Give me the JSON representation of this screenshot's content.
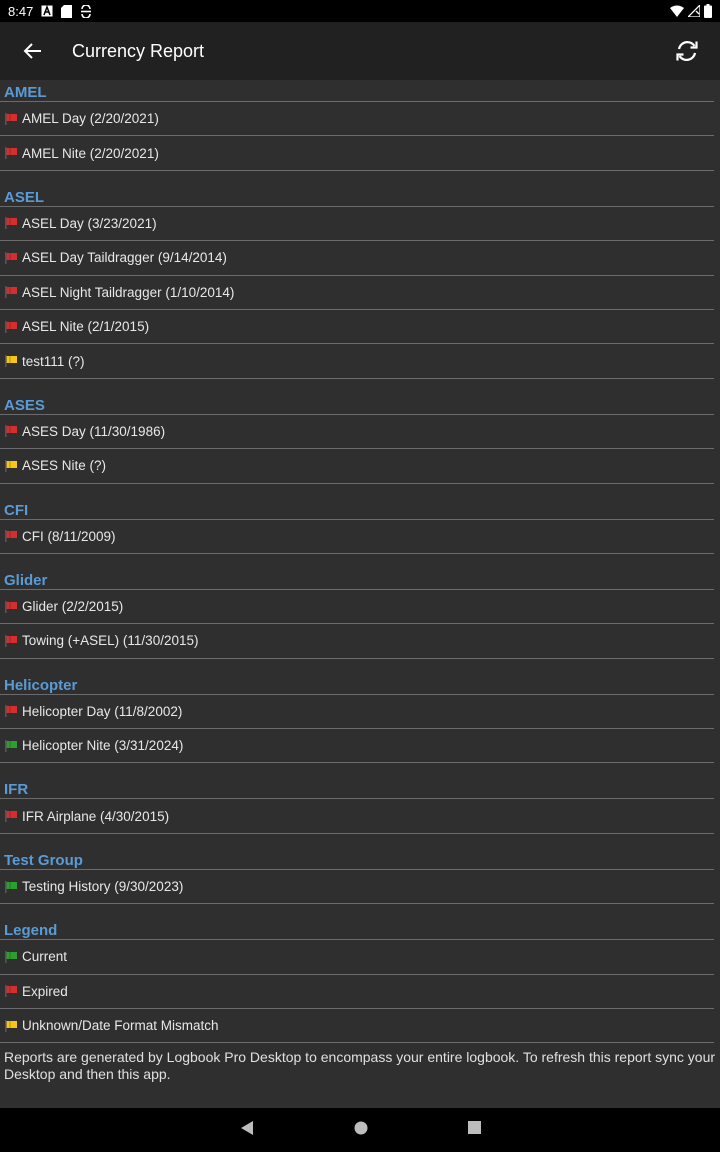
{
  "status": {
    "time": "8:47"
  },
  "appbar": {
    "title": "Currency Report"
  },
  "groups": [
    {
      "name": "AMEL",
      "items": [
        {
          "label": "AMEL Day (2/20/2021)",
          "flag": "red"
        },
        {
          "label": "AMEL Nite (2/20/2021)",
          "flag": "red"
        }
      ]
    },
    {
      "name": "ASEL",
      "items": [
        {
          "label": "ASEL Day (3/23/2021)",
          "flag": "red"
        },
        {
          "label": "ASEL Day Taildragger (9/14/2014)",
          "flag": "red"
        },
        {
          "label": "ASEL Night Taildragger (1/10/2014)",
          "flag": "red"
        },
        {
          "label": "ASEL Nite (2/1/2015)",
          "flag": "red"
        },
        {
          "label": "test111 (?)",
          "flag": "yellow"
        }
      ]
    },
    {
      "name": "ASES",
      "items": [
        {
          "label": "ASES Day (11/30/1986)",
          "flag": "red"
        },
        {
          "label": "ASES Nite (?)",
          "flag": "yellow"
        }
      ]
    },
    {
      "name": "CFI",
      "items": [
        {
          "label": "CFI (8/11/2009)",
          "flag": "red"
        }
      ]
    },
    {
      "name": "Glider",
      "items": [
        {
          "label": "Glider (2/2/2015)",
          "flag": "red"
        },
        {
          "label": "Towing (+ASEL) (11/30/2015)",
          "flag": "red"
        }
      ]
    },
    {
      "name": "Helicopter",
      "items": [
        {
          "label": "Helicopter Day (11/8/2002)",
          "flag": "red"
        },
        {
          "label": "Helicopter Nite (3/31/2024)",
          "flag": "green"
        }
      ]
    },
    {
      "name": "IFR",
      "items": [
        {
          "label": "IFR Airplane (4/30/2015)",
          "flag": "red"
        }
      ]
    },
    {
      "name": "Test Group",
      "items": [
        {
          "label": "Testing History (9/30/2023)",
          "flag": "green"
        }
      ]
    },
    {
      "name": "Legend",
      "items": [
        {
          "label": "Current",
          "flag": "green"
        },
        {
          "label": "Expired",
          "flag": "red"
        },
        {
          "label": "Unknown/Date Format Mismatch",
          "flag": "yellow"
        }
      ]
    }
  ],
  "footer": {
    "text": "Reports are generated by Logbook Pro Desktop to encompass your entire logbook. To refresh this report sync your Desktop and then this app."
  },
  "colors": {
    "red": "#d32f2f",
    "yellow": "#f5c518",
    "green": "#2e9e2e",
    "header": "#5b9bd5"
  },
  "icons": {
    "back": "arrow-left-icon",
    "refresh": "sync-icon"
  }
}
